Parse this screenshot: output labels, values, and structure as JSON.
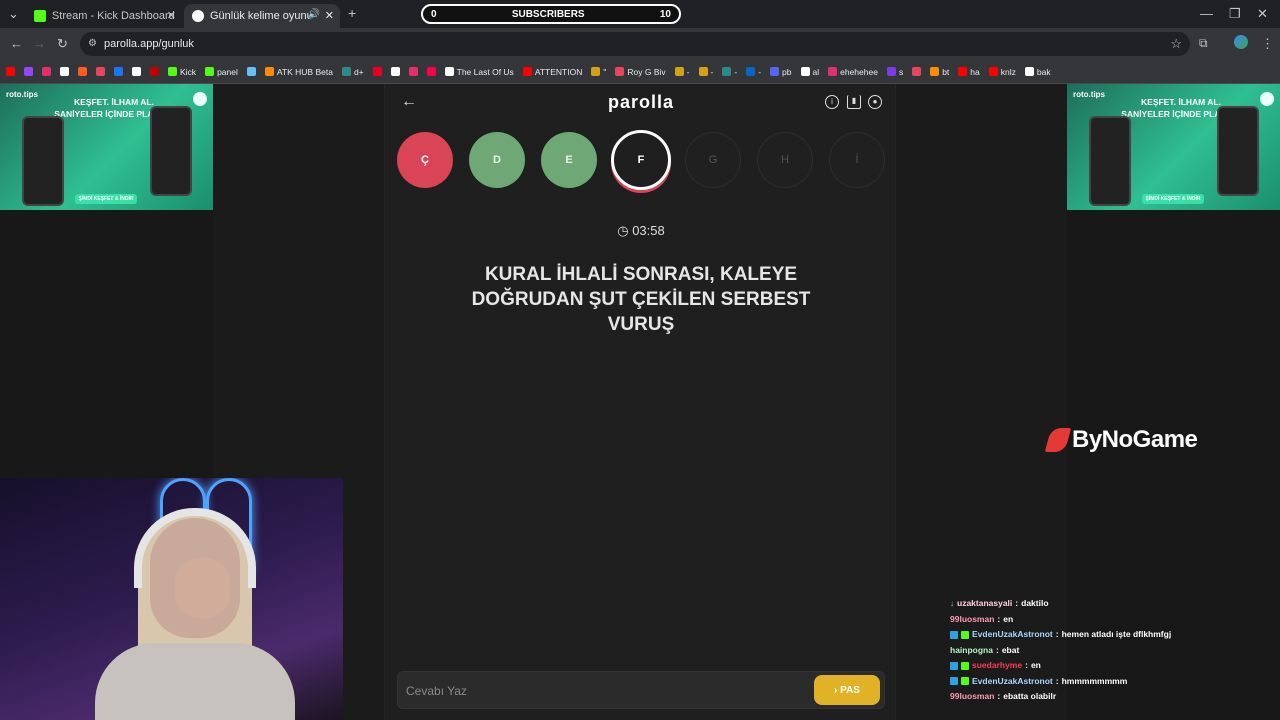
{
  "browser": {
    "tabs": [
      {
        "title": "Stream - Kick Dashboard",
        "active": false,
        "favicon_color": "#53fc18"
      },
      {
        "title": "Günlük kelime oyunu - par",
        "active": true,
        "favicon_color": "#ffffff"
      }
    ],
    "address": "parolla.app/gunluk",
    "bookmarks": [
      {
        "label": "",
        "color": "#ff0000"
      },
      {
        "label": "",
        "color": "#9146ff"
      },
      {
        "label": "",
        "color": "#e1306c"
      },
      {
        "label": "",
        "color": "#ffffff"
      },
      {
        "label": "",
        "color": "#ff5a1f"
      },
      {
        "label": "",
        "color": "#e94560"
      },
      {
        "label": "",
        "color": "#1877f2"
      },
      {
        "label": "",
        "color": "#ffffff"
      },
      {
        "label": "",
        "color": "#c00000"
      },
      {
        "label": "Kick",
        "color": "#53fc18"
      },
      {
        "label": "panel",
        "color": "#53fc18"
      },
      {
        "label": "",
        "color": "#66c0f4"
      },
      {
        "label": "ATK HUB Beta",
        "color": "#ff8c00"
      },
      {
        "label": "d+",
        "color": "#2b8a8a"
      },
      {
        "label": "",
        "color": "#e60023"
      },
      {
        "label": "",
        "color": "#ffffff"
      },
      {
        "label": "",
        "color": "#e1306c"
      },
      {
        "label": "",
        "color": "#ff0050"
      },
      {
        "label": "The Last Of Us",
        "color": "#ffffff"
      },
      {
        "label": "ATTENTION",
        "color": "#ff0000"
      },
      {
        "label": "\"",
        "color": "#d4a017"
      },
      {
        "label": "Roy G Biv",
        "color": "#e94560"
      },
      {
        "label": "-",
        "color": "#d4a017"
      },
      {
        "label": "-",
        "color": "#d4a017"
      },
      {
        "label": "-",
        "color": "#2b8a8a"
      },
      {
        "label": "-",
        "color": "#0a66c2"
      },
      {
        "label": "pb",
        "color": "#5865f2"
      },
      {
        "label": "al",
        "color": "#ffffff"
      },
      {
        "label": "ehehehee",
        "color": "#e1306c"
      },
      {
        "label": "s",
        "color": "#7c3aed"
      },
      {
        "label": "",
        "color": "#e94560"
      },
      {
        "label": "bt",
        "color": "#ff8c00"
      },
      {
        "label": "ha",
        "color": "#ff0000"
      },
      {
        "label": "knlz",
        "color": "#ff0000"
      },
      {
        "label": "bak",
        "color": "#ffffff"
      }
    ]
  },
  "overlay": {
    "subscribers_label": "SUBSCRIBERS",
    "subscribers_current": "0",
    "subscribers_goal": "10",
    "sponsor": "ByNoGame"
  },
  "ad": {
    "brand": "roto.tips",
    "headline": "KEŞFET. İLHAM AL. SANİYELER İÇİNDE PLANLA!",
    "cta": "ŞİMDİ KEŞFET & İNDİR"
  },
  "game": {
    "logo": "parolla",
    "letters": [
      {
        "char": "Ç",
        "state": "wrong"
      },
      {
        "char": "D",
        "state": "right"
      },
      {
        "char": "E",
        "state": "right"
      },
      {
        "char": "F",
        "state": "current"
      },
      {
        "char": "G",
        "state": "pending"
      },
      {
        "char": "H",
        "state": "pending"
      },
      {
        "char": "İ",
        "state": "pending"
      }
    ],
    "timer": "03:58",
    "question": "KURAL İHLALİ SONRASI, KALEYE DOĞRUDAN ŞUT ÇEKİLEN SERBEST VURUŞ",
    "answer_placeholder": "Cevabı Yaz",
    "pass_label": "PAS"
  },
  "chat": [
    {
      "user": "uzaktanasyali",
      "color": "#ffd1dc",
      "message": "daktilo"
    },
    {
      "user": "99luosman",
      "color": "#ff9ab0",
      "message": "en"
    },
    {
      "user": "EvdenUzakAstronot",
      "color": "#a9d7ff",
      "message": "hemen atladı işte dflkhmfgj"
    },
    {
      "user": "hainpogna",
      "color": "#b6f5c8",
      "message": "ebat"
    },
    {
      "user": "suedarhyme",
      "color": "#ff3b5c",
      "message": "en"
    },
    {
      "user": "EvdenUzakAstronot",
      "color": "#a9d7ff",
      "message": "hmmmmmmmm"
    },
    {
      "user": "99luosman",
      "color": "#ff9ab0",
      "message": "ebatta olabilr"
    }
  ]
}
